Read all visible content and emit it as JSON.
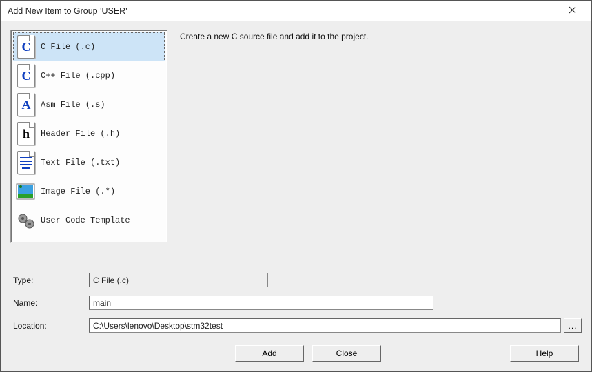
{
  "titlebar": {
    "title": "Add New Item to Group 'USER'"
  },
  "types": [
    {
      "label": "C File (.c)",
      "icon": "c-file-icon",
      "letter": "C",
      "color": "#1040c0",
      "selected": true
    },
    {
      "label": "C++ File (.cpp)",
      "icon": "cpp-file-icon",
      "letter": "C",
      "color": "#1040c0",
      "selected": false
    },
    {
      "label": "Asm File (.s)",
      "icon": "asm-file-icon",
      "letter": "A",
      "color": "#1040c0",
      "selected": false
    },
    {
      "label": "Header File (.h)",
      "icon": "header-file-icon",
      "letter": "h",
      "color": "#000",
      "selected": false
    },
    {
      "label": "Text File (.txt)",
      "icon": "text-file-icon",
      "letter": "",
      "color": "#1040c0",
      "selected": false
    },
    {
      "label": "Image File (.*)",
      "icon": "image-file-icon",
      "letter": "",
      "color": "",
      "selected": false
    },
    {
      "label": "User Code Template",
      "icon": "user-code-icon",
      "letter": "",
      "color": "",
      "selected": false
    }
  ],
  "description": "Create a new C source file and add it to the project.",
  "form": {
    "type_label": "Type:",
    "type_value": "C File (.c)",
    "name_label": "Name:",
    "name_value": "main",
    "location_label": "Location:",
    "location_value": "C:\\Users\\lenovo\\Desktop\\stm32test",
    "browse_label": "..."
  },
  "buttons": {
    "add": "Add",
    "close": "Close",
    "help": "Help"
  }
}
